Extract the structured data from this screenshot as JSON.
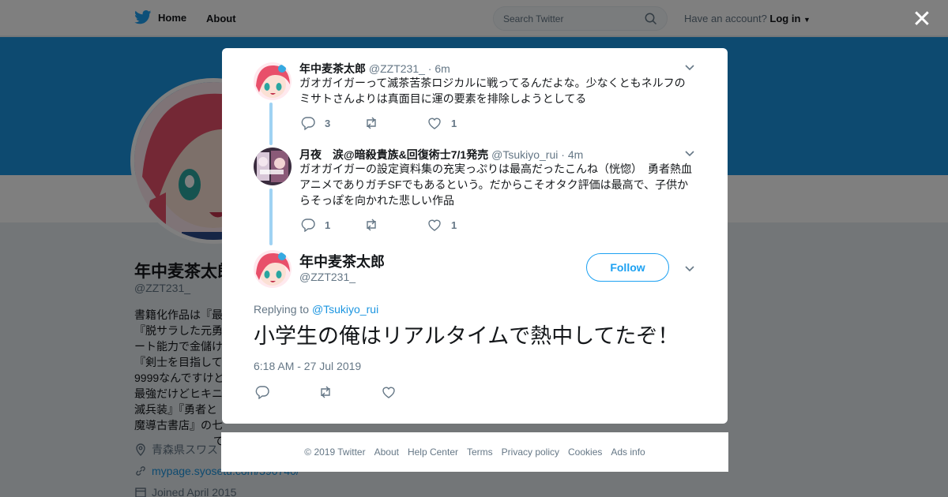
{
  "topbar": {
    "home_label": "Home",
    "about_label": "About",
    "search_placeholder": "Search Twitter",
    "have_account": "Have an account?",
    "login_label": "Log in"
  },
  "profile": {
    "name": "年中麦茶太郎",
    "handle": "@ZZT231_",
    "bio_lines": [
      "書籍化作品は『最",
      "『脱サラした元勇",
      "ート能力で金儲け",
      "『剣士を目指して",
      "9999なんですけど",
      "最強だけどヒキニ",
      "滅兵装』『勇者と",
      "魔導古書店』の七"
    ],
    "bio_tail": "です。",
    "location": "青森県スワス",
    "website": "mypage.syosetu.com/390740/",
    "joined": "Joined April 2015"
  },
  "modal": {
    "tweets": [
      {
        "name": "年中麦茶太郎",
        "handle": "@ZZT231_",
        "time": "· 6m",
        "text": "ガオガイガーって滅茶苦茶ロジカルに戦ってるんだよな。少なくともネルフのミサトさんよりは真面目に運の要素を排除しようとしてる",
        "replies": "3",
        "retweets": "",
        "likes": "1"
      },
      {
        "name": "月夜　涙@暗殺貴族&回復術士7/1発売",
        "handle": "@Tsukiyo_rui",
        "time": "· 4m",
        "text": "ガオガイガーの設定資料集の充実っぷりは最高だったこんね（恍惚）　勇者熱血アニメでありガチSFでもあるという。だからこそオタク評価は最高で、子供からそっぽを向かれた悲しい作品",
        "replies": "1",
        "retweets": "",
        "likes": "1"
      }
    ],
    "main_tweet": {
      "name": "年中麦茶太郎",
      "handle": "@ZZT231_",
      "follow_label": "Follow",
      "replying_to_label": "Replying to",
      "replying_to_handle": "@Tsukiyo_rui",
      "text": "小学生の俺はリアルタイムで熱中してたぞ！",
      "timestamp": "6:18 AM - 27 Jul 2019"
    }
  },
  "footer": {
    "copyright": "© 2019 Twitter",
    "links": [
      "About",
      "Help Center",
      "Terms",
      "Privacy policy",
      "Cookies",
      "Ads info"
    ]
  },
  "colors": {
    "accent": "#1da1f2",
    "banner": "#1b95e0",
    "thread_line": "#9fd2f3",
    "muted_text": "#657786"
  },
  "icons": [
    "twitter-bird-icon",
    "search-icon",
    "caret-down-icon",
    "close-icon",
    "reply-icon",
    "retweet-icon",
    "like-icon",
    "location-icon",
    "link-icon",
    "calendar-icon"
  ]
}
